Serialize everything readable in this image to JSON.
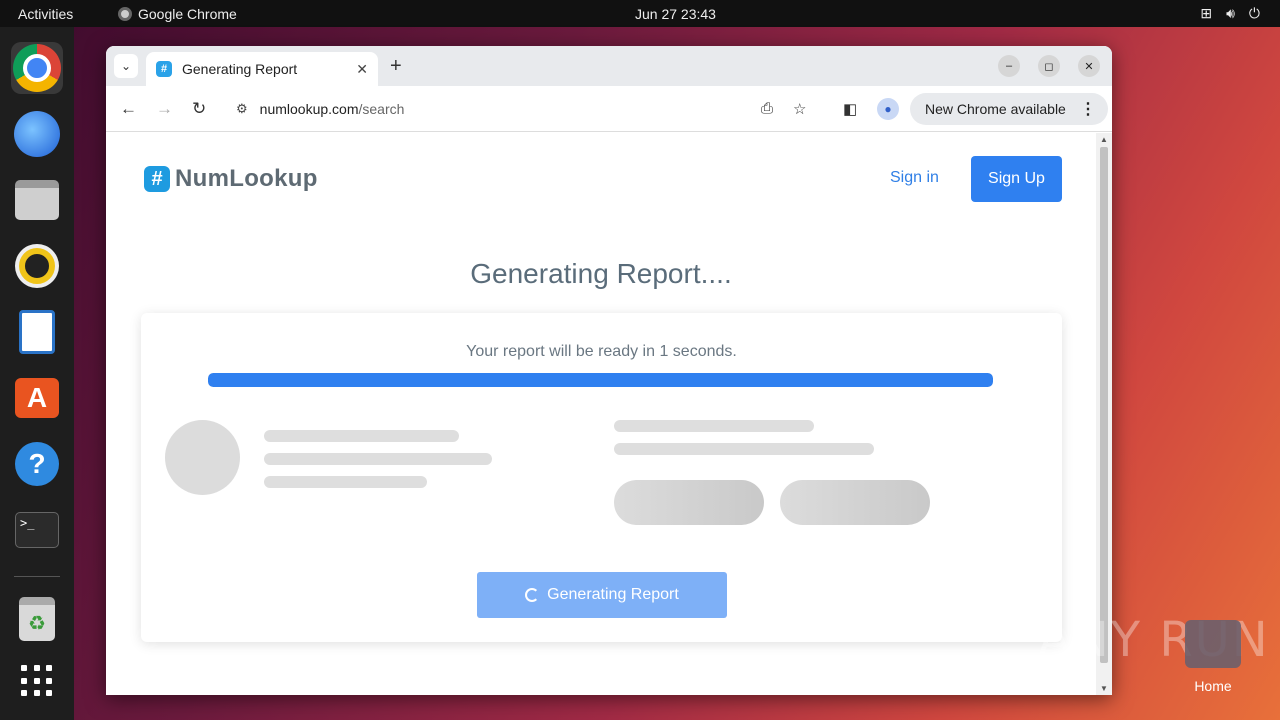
{
  "topbar": {
    "activities": "Activities",
    "app_name": "Google Chrome",
    "clock": "Jun 27  23:43",
    "tray_icons": [
      "network-icon",
      "volume-icon",
      "power-icon"
    ]
  },
  "dock": {
    "items": [
      "chrome-icon",
      "thunderbird-icon",
      "files-icon",
      "rhythmbox-icon",
      "writer-icon",
      "app-center-icon",
      "help-icon",
      "terminal-icon",
      "trash-icon",
      "show-apps-icon"
    ],
    "help_glyph": "?",
    "terminal_glyph": ">_",
    "trash_glyph": "♻"
  },
  "browser": {
    "tab_title": "Generating Report",
    "tab_favicon": "#",
    "new_tab": "+",
    "url_domain": "numlookup.com",
    "url_path": "/search",
    "update_label": "New Chrome available"
  },
  "site": {
    "logo_mark": "#",
    "logo_text": "NumLookup",
    "sign_in": "Sign in",
    "sign_up": "Sign Up",
    "heading": "Generating Report....",
    "ready_text": "Your report will be ready in 1 seconds.",
    "progress": 1.0,
    "button_label": "Generating Report",
    "accent": "#2f80f0"
  },
  "desktop": {
    "watermark": "ANY RUN",
    "home_label": "Home"
  }
}
